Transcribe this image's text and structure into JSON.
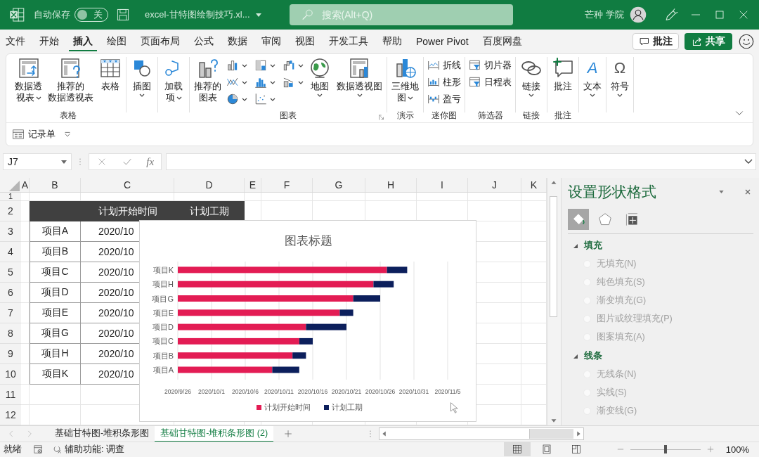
{
  "title_bar": {
    "autosave": {
      "label": "自动保存",
      "on": false,
      "state": "关"
    },
    "file_name": "excel-甘特图绘制技巧.xl...",
    "search": {
      "placeholder": "搜索(Alt+Q)"
    },
    "user_name": "芒种 学院"
  },
  "menu": {
    "tabs": [
      {
        "label": "文件",
        "selected": false
      },
      {
        "label": "开始",
        "selected": false
      },
      {
        "label": "插入",
        "selected": true
      },
      {
        "label": "绘图",
        "selected": false
      },
      {
        "label": "页面布局",
        "selected": false
      },
      {
        "label": "公式",
        "selected": false
      },
      {
        "label": "数据",
        "selected": false
      },
      {
        "label": "审阅",
        "selected": false
      },
      {
        "label": "视图",
        "selected": false
      },
      {
        "label": "开发工具",
        "selected": false
      },
      {
        "label": "帮助",
        "selected": false
      },
      {
        "label": "Power Pivot",
        "selected": false
      },
      {
        "label": "百度网盘",
        "selected": false
      }
    ],
    "comment_button": "批注",
    "share_button": "共享"
  },
  "ribbon": {
    "groups": [
      {
        "label": "表格",
        "items": [
          {
            "kind": "large",
            "lines": [
              "数据透",
              "视表"
            ],
            "dropdown": true
          },
          {
            "kind": "large",
            "lines": [
              "推荐的",
              "数据透视表"
            ],
            "dropdown": false
          },
          {
            "kind": "large",
            "lines": [
              "表格"
            ],
            "dropdown": false
          }
        ]
      },
      {
        "items": [
          {
            "kind": "large",
            "lines": [
              "插图"
            ],
            "dropdown": true
          }
        ]
      },
      {
        "items": [
          {
            "kind": "large",
            "lines": [
              "加载",
              "项"
            ],
            "dropdown": true
          }
        ]
      },
      {
        "label": "图表",
        "items": [
          {
            "kind": "large",
            "lines": [
              "推荐的",
              "图表"
            ],
            "dropdown": false
          },
          {
            "kind": "icon",
            "dropdown": true
          },
          {
            "kind": "icon",
            "dropdown": true
          },
          {
            "kind": "icon",
            "dropdown": true
          },
          {
            "kind": "icon",
            "dropdown": true
          },
          {
            "kind": "icon",
            "dropdown": true
          },
          {
            "kind": "icon",
            "dropdown": true
          },
          {
            "kind": "icon",
            "dropdown": true
          },
          {
            "kind": "icon",
            "dropdown": true
          },
          {
            "kind": "large",
            "lines": [
              "地图"
            ],
            "dropdown": true
          },
          {
            "kind": "large",
            "lines": [
              "数据透视图"
            ],
            "dropdown": true
          }
        ]
      },
      {
        "label": "演示",
        "items": [
          {
            "kind": "large",
            "lines": [
              "三维地",
              "图"
            ],
            "dropdown": true
          }
        ]
      },
      {
        "label": "迷你图",
        "items": [
          {
            "kind": "small",
            "label": "折线",
            "dropdown": false
          },
          {
            "kind": "small",
            "label": "柱形",
            "dropdown": false
          },
          {
            "kind": "small",
            "label": "盈亏",
            "dropdown": false
          }
        ]
      },
      {
        "label": "筛选器",
        "items": [
          {
            "kind": "small",
            "label": "切片器",
            "dropdown": false
          },
          {
            "kind": "small",
            "label": "日程表",
            "dropdown": false
          }
        ]
      },
      {
        "label": "链接",
        "items": [
          {
            "kind": "large",
            "lines": [
              "链接"
            ],
            "dropdown": true
          }
        ]
      },
      {
        "label": "批注",
        "items": [
          {
            "kind": "large",
            "lines": [
              "批注"
            ],
            "dropdown": false
          }
        ]
      },
      {
        "items": [
          {
            "kind": "large",
            "glyph": "A",
            "lines": [
              "文本"
            ],
            "dropdown": true
          }
        ]
      },
      {
        "items": [
          {
            "kind": "large",
            "glyph": "Ω",
            "lines": [
              "符号"
            ],
            "dropdown": true
          }
        ]
      }
    ],
    "quick_access": {
      "label": "记录单"
    }
  },
  "formula_bar": {
    "name_box": "J7",
    "function_label": "fx"
  },
  "sheet": {
    "columns": [
      "A",
      "B",
      "C",
      "D",
      "E",
      "F",
      "G",
      "H",
      "I",
      "J",
      "K"
    ],
    "rows": [
      "1",
      "2",
      "3",
      "4",
      "5",
      "6",
      "7",
      "8",
      "9",
      "10",
      "11",
      "12"
    ],
    "table": {
      "header": [
        "计划开始时间",
        "计划工期"
      ],
      "rows": [
        {
          "name": "项目A",
          "start": "2020/10"
        },
        {
          "name": "项目B",
          "start": "2020/10"
        },
        {
          "name": "项目C",
          "start": "2020/10"
        },
        {
          "name": "项目D",
          "start": "2020/10"
        },
        {
          "name": "项目E",
          "start": "2020/10"
        },
        {
          "name": "项目G",
          "start": "2020/10"
        },
        {
          "name": "项目H",
          "start": "2020/10"
        },
        {
          "name": "项目K",
          "start": "2020/10"
        }
      ]
    }
  },
  "chart": {
    "title": "图表标题",
    "categories": [
      "项目K",
      "项目H",
      "项目G",
      "项目E",
      "项目D",
      "项目C",
      "项目B",
      "项目A"
    ],
    "axis_labels": [
      "2020/9/26",
      "2020/10/1",
      "2020/10/6",
      "2020/10/11",
      "2020/10/16",
      "2020/10/21",
      "2020/10/26",
      "2020/10/31",
      "2020/11/5"
    ],
    "legend": [
      {
        "name": "计划开始时间",
        "color": "#e31c54"
      },
      {
        "name": "计划工期",
        "color": "#0c1f5c"
      }
    ]
  },
  "format_pane": {
    "title": "设置形状格式",
    "tabs": [
      {
        "selected": true
      },
      {
        "selected": false
      },
      {
        "selected": false
      }
    ],
    "sections": [
      {
        "label": "填充",
        "expanded": true,
        "options": [
          {
            "label": "无填充(N)",
            "selected": false,
            "disabled": true
          },
          {
            "label": "纯色填充(S)",
            "selected": false,
            "disabled": true
          },
          {
            "label": "渐变填充(G)",
            "selected": false,
            "disabled": true
          },
          {
            "label": "图片或纹理填充(P)",
            "selected": false,
            "disabled": true
          },
          {
            "label": "图案填充(A)",
            "selected": false,
            "disabled": true
          }
        ]
      },
      {
        "label": "线条",
        "expanded": true,
        "options": [
          {
            "label": "无线条(N)",
            "selected": false,
            "disabled": true
          },
          {
            "label": "实线(S)",
            "selected": false,
            "disabled": true
          },
          {
            "label": "渐变线(G)",
            "selected": false,
            "disabled": true
          }
        ]
      }
    ]
  },
  "sheet_tabs": [
    {
      "label": "基础甘特图-堆积条形图",
      "selected": false
    },
    {
      "label": "基础甘特图-堆积条形图 (2)",
      "selected": true
    }
  ],
  "status_bar": {
    "status": "就绪",
    "accessibility": "辅助功能: 调查",
    "views": [
      {
        "selected": true
      },
      {
        "selected": false
      },
      {
        "selected": false
      }
    ],
    "zoom": {
      "level": 0.5,
      "reading": "100%"
    }
  }
}
